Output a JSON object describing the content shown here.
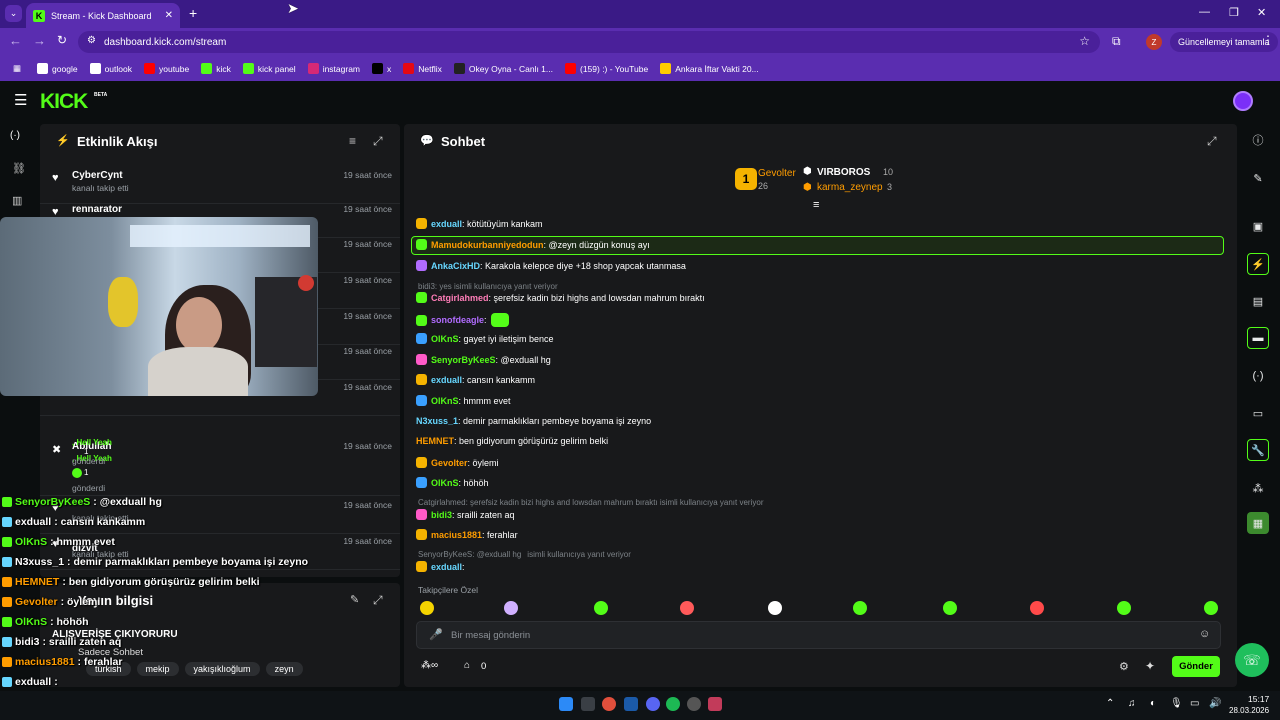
{
  "browser": {
    "tab_title": "Stream - Kick Dashboard",
    "url": "dashboard.kick.com/stream",
    "update_btn": "Güncellemeyi tamamla",
    "profile_letter": "Z",
    "bookmarks": [
      {
        "label": "google",
        "color": "#ffffff"
      },
      {
        "label": "outlook",
        "color": "#ffffff"
      },
      {
        "label": "youtube",
        "color": "#ff0000"
      },
      {
        "label": "kick",
        "color": "#53fc18"
      },
      {
        "label": "kick panel",
        "color": "#53fc18"
      },
      {
        "label": "instagram",
        "color": "#d62976"
      },
      {
        "label": "x",
        "color": "#000000"
      },
      {
        "label": "Netflix",
        "color": "#e50914"
      },
      {
        "label": "Okey Oyna - Canlı 1...",
        "color": "#222222"
      },
      {
        "label": "(159) :) - YouTube",
        "color": "#ff0000"
      },
      {
        "label": "Ankara İftar Vakti 20...",
        "color": "#ffcc00"
      }
    ]
  },
  "kick": {
    "logo": "KICK",
    "beta": "BETA"
  },
  "activity": {
    "title": "Etkinlik Akışı",
    "items": [
      {
        "name": "CyberCynt",
        "sub": "kanalı takip etti",
        "time": "19 saat önce"
      },
      {
        "name": "rennarator",
        "sub": "",
        "time": "19 saat önce"
      },
      {
        "name": "",
        "sub": "",
        "time": "19 saat önce"
      },
      {
        "name": "",
        "sub": "",
        "time": "19 saat önce"
      },
      {
        "name": "",
        "sub": "",
        "time": "19 saat önce"
      },
      {
        "name": "",
        "sub": "",
        "time": "19 saat önce"
      },
      {
        "name": "",
        "sub": "",
        "time": "19 saat önce"
      },
      {
        "name": "Ablullah",
        "sub": "gönderdi",
        "time": "19 saat önce"
      },
      {
        "name": "",
        "sub": "kanalı takip etti",
        "time": "19 saat önce"
      },
      {
        "name": "",
        "sub": "kanalı takip etti",
        "time": "19 saat önce"
      }
    ],
    "hell_yeah": ", Hell Yeah",
    "count": "1",
    "sent": "gönderdi",
    "partial_name": "dizvit"
  },
  "stream_info": {
    "title": "Yayın bilgisi",
    "stream_title": "ALIŞVERİŞE ÇIKIYORURU",
    "category": "Sadece Sohbet",
    "tags": [
      "türkish",
      "mekip",
      "yakışıklıoğlum",
      "zeyn"
    ]
  },
  "chat": {
    "title": "Sohbet",
    "leaders": [
      {
        "rank": "1",
        "name": "Gevolter",
        "count": "26"
      },
      {
        "name": "VIRBOROS",
        "count": "10"
      },
      {
        "name": "karma_zeynep",
        "count": "3"
      }
    ],
    "messages": [
      {
        "name": "exduall",
        "color": "#67d7ff",
        "text": ": kötütüyüm kankam"
      },
      {
        "name": "Mamudokurbanniyedodun",
        "color": "#ff9d00",
        "text": ": @zeyn düzgün konuş ayı"
      },
      {
        "name": "AnkaCixHD",
        "color": "#67d7ff",
        "text": ": Karakola kelepce diye +18 shop yapcak utanmasa"
      },
      {
        "name": "Catgirlahmed",
        "color": "#ff7db8",
        "text": ": şerefsiz kadin bizi highs and lowsdan mahrum bıraktı"
      },
      {
        "name": "sonofdeagle",
        "color": "#b16cff",
        "text": ":"
      },
      {
        "name": "OlKnS",
        "color": "#53fc18",
        "text": ": gayet iyi iletişim bence"
      },
      {
        "name": "SenyorByKeeS",
        "color": "#53fc18",
        "text": ": @exduall hg"
      },
      {
        "name": "exduall",
        "color": "#67d7ff",
        "text": ": cansın kankamm"
      },
      {
        "name": "OlKnS",
        "color": "#53fc18",
        "text": ": hmmm evet"
      },
      {
        "name": "N3xuss_1",
        "color": "#67d7ff",
        "text": ": demir parmaklıkları pembeye boyama işi zeyno"
      },
      {
        "name": "HEMNET",
        "color": "#ff9d00",
        "text": ": ben gidiyorum görüşürüz gelirim belki"
      },
      {
        "name": "Gevolter",
        "color": "#ff9d00",
        "text": ": öylemi"
      },
      {
        "name": "OlKnS",
        "color": "#53fc18",
        "text": ": höhöh"
      },
      {
        "name": "bidi3",
        "color": "#53fc18",
        "text": ": srailli zaten aq"
      },
      {
        "name": "macius1881",
        "color": "#ff9d00",
        "text": ": ferahlar"
      },
      {
        "name": "exduall",
        "color": "#67d7ff",
        "text": ":"
      }
    ],
    "reply1": "bidi3: yes isimli kullanıcıya yanıt veriyor",
    "reply2": "Catgirlahmed: şerefsiz kadin bizi highs and lowsdan mahrum bıraktı isimli kullanıcıya yanıt veriyor",
    "reply3a": "SenyorByKeeS: @exduall hg",
    "reply3b": "isimli kullanıcıya yanıt veriyor",
    "followers_only": "Takipçilere Özel",
    "placeholder": "Bir mesaj gönderin",
    "count": "0",
    "send": "Gönder"
  },
  "overlay": [
    {
      "name": "SenyorByKeeS",
      "color": "#53fc18",
      "text": ": @exduall hg"
    },
    {
      "name": "exduall",
      "color": "#ffffff",
      "text": ": cansın kankamm"
    },
    {
      "name": "OlKnS",
      "color": "#53fc18",
      "text": ": hmmm evet"
    },
    {
      "name": "N3xuss_1",
      "color": "#ffffff",
      "text": ": demir parmaklıkları pembeye boyama işi zeyno"
    },
    {
      "name": "HEMNET",
      "color": "#ff9d00",
      "text": ": ben gidiyorum görüşürüz gelirim belki"
    },
    {
      "name": "Gevolter",
      "color": "#ff9d00",
      "text": ": öylemi"
    },
    {
      "name": "OlKnS",
      "color": "#53fc18",
      "text": ": höhöh"
    },
    {
      "name": "bidi3",
      "color": "#ffffff",
      "text": ": srailli zaten aq"
    },
    {
      "name": "macius1881",
      "color": "#ff9d00",
      "text": ": ferahlar"
    },
    {
      "name": "exduall",
      "color": "#ffffff",
      "text": ":"
    }
  ],
  "taskbar": {
    "time": "15:17",
    "date": "28.03.2026"
  }
}
